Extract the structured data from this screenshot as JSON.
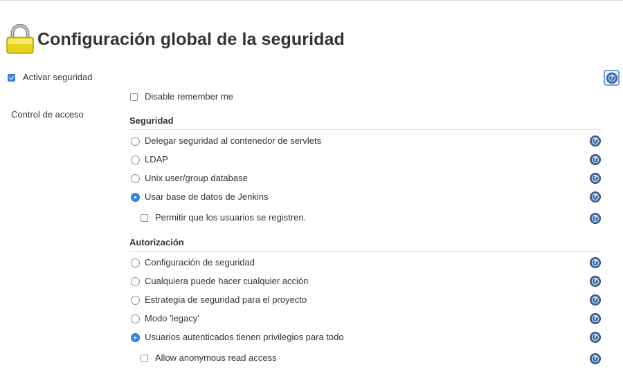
{
  "page": {
    "title": "Configuración global de la seguridad"
  },
  "security": {
    "enable_label": "Activar seguridad",
    "enable_checked": true,
    "disable_remember_label": "Disable remember me",
    "disable_remember_checked": false,
    "access_control_label": "Control de acceso"
  },
  "realm": {
    "heading": "Seguridad",
    "options": [
      {
        "label": "Delegar seguridad al contenedor de servlets",
        "selected": false
      },
      {
        "label": "LDAP",
        "selected": false
      },
      {
        "label": "Unix user/group database",
        "selected": false
      },
      {
        "label": "Usar base de datos de Jenkins",
        "selected": true
      }
    ],
    "allow_signup_label": "Permitir que los usuarios se registren.",
    "allow_signup_checked": false
  },
  "authorization": {
    "heading": "Autorización",
    "options": [
      {
        "label": "Configuración de seguridad",
        "selected": false
      },
      {
        "label": "Cualquiera puede hacer cualquier acción",
        "selected": false
      },
      {
        "label": "Estrategia de seguridad para el proyecto",
        "selected": false
      },
      {
        "label": "Modo 'legacy'",
        "selected": false
      },
      {
        "label": "Usuarios autenticados tienen privilegios para todo",
        "selected": true
      }
    ],
    "anonymous_read_label": "Allow anonymous read access",
    "anonymous_read_checked": false
  },
  "help_glyph": "?",
  "icons": [
    "lock-icon",
    "help-icon"
  ],
  "colors": {
    "accent": "#3a84e8",
    "help": "#3f6aa3"
  }
}
